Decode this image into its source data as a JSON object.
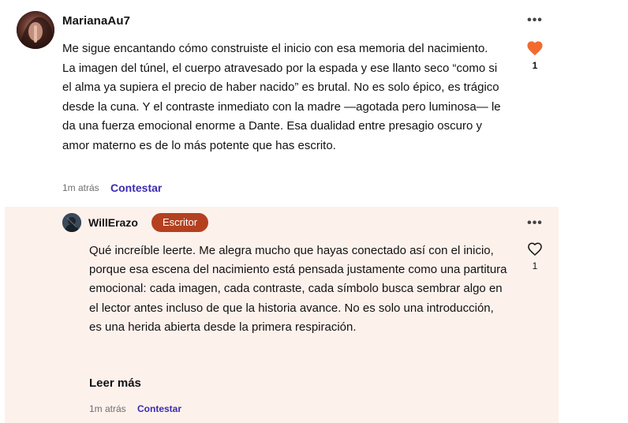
{
  "comment": {
    "username": "MarianaAu7",
    "more_label": "•••",
    "paragraph": "Me sigue encantando cómo construiste el inicio con esa memoria del nacimiento. La imagen del túnel, el cuerpo atravesado por la espada y ese llanto seco “como si el alma ya supiera el precio de haber nacido” es brutal. No es solo épico, es trágico desde la cuna. Y el contraste inmediato con la madre —agotada pero luminosa— le da una fuerza emocional enorme a Dante. Esa dualidad entre presagio oscuro y amor materno es de lo más potente que has escrito.",
    "likes": "1",
    "liked": true,
    "time": "1m atrás",
    "reply_label": "Contestar",
    "heart_color": "#f26a2e"
  },
  "reply": {
    "username": "WillErazo",
    "badge": "Escritor",
    "badge_color": "#b4401f",
    "more_label": "•••",
    "paragraph": "Qué increíble leerte. Me alegra mucho que hayas conectado así con el inicio, porque esa escena del nacimiento está pensada justamente como una partitura emocional: cada imagen, cada contraste, cada símbolo busca sembrar algo en el lector antes incluso de que la historia avance. No es solo una introducción, es una herida abierta desde la primera respiración.",
    "likes": "1",
    "liked": false,
    "read_more_label": "Leer más",
    "time": "1m atrás",
    "reply_label": "Contestar",
    "background": "#fdf1ec"
  },
  "colors": {
    "link": "#3a2cb0",
    "muted_text": "#6f6f6f"
  }
}
